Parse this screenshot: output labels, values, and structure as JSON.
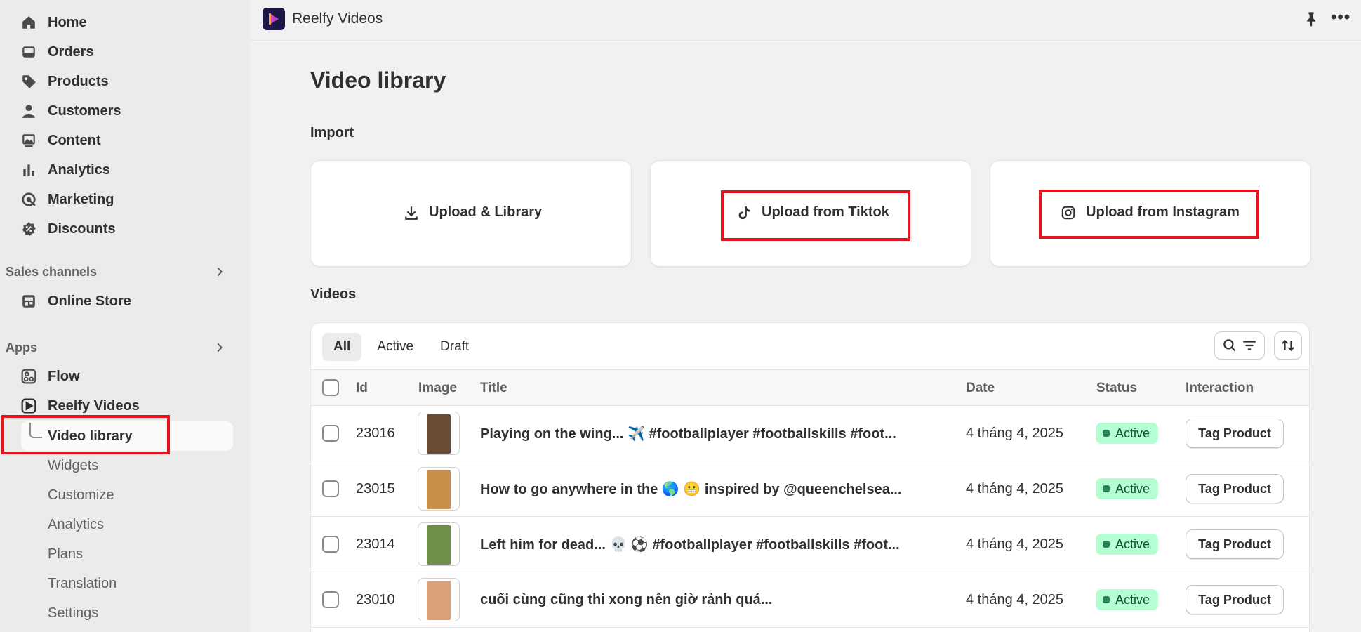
{
  "sidebar": {
    "main_items": [
      {
        "label": "Home",
        "icon": "home-icon"
      },
      {
        "label": "Orders",
        "icon": "inbox-icon"
      },
      {
        "label": "Products",
        "icon": "tag-icon"
      },
      {
        "label": "Customers",
        "icon": "person-icon"
      },
      {
        "label": "Content",
        "icon": "image-icon"
      },
      {
        "label": "Analytics",
        "icon": "bar-chart-icon"
      },
      {
        "label": "Marketing",
        "icon": "target-icon"
      },
      {
        "label": "Discounts",
        "icon": "discount-icon"
      }
    ],
    "sales_channels": {
      "title": "Sales channels",
      "items": [
        {
          "label": "Online Store",
          "icon": "store-icon"
        }
      ]
    },
    "apps": {
      "title": "Apps",
      "items": [
        {
          "label": "Flow",
          "icon": "flow-icon"
        },
        {
          "label": "Reelfy Videos",
          "icon": "play-icon"
        }
      ],
      "sub_items": [
        "Video library",
        "Widgets",
        "Customize",
        "Analytics",
        "Plans",
        "Translation",
        "Settings"
      ]
    }
  },
  "topbar": {
    "app_title": "Reelfy Videos"
  },
  "page": {
    "title": "Video library",
    "import_label": "Import",
    "import_buttons": [
      "Upload & Library",
      "Upload from Tiktok",
      "Upload from Instagram"
    ],
    "videos_label": "Videos"
  },
  "videos": {
    "tabs": [
      "All",
      "Active",
      "Draft"
    ],
    "selected_tab": "All",
    "columns": [
      "Id",
      "Image",
      "Title",
      "Date",
      "Status",
      "Interaction"
    ],
    "rows": [
      {
        "id": "23016",
        "title": "Playing on the wing... ✈️ #footballplayer #footballskills #foot...",
        "date": "4 tháng 4, 2025",
        "status": "Active",
        "action": "Tag Product",
        "thumb_color": "#6b4a36"
      },
      {
        "id": "23015",
        "title": "How to go anywhere in the 🌎 😬 inspired by @queenchelsea...",
        "date": "4 tháng 4, 2025",
        "status": "Active",
        "action": "Tag Product",
        "thumb_color": "#c78f4a"
      },
      {
        "id": "23014",
        "title": "Left him for dead... 💀 ⚽ #footballplayer #footballskills #foot...",
        "date": "4 tháng 4, 2025",
        "status": "Active",
        "action": "Tag Product",
        "thumb_color": "#6f8f4a"
      },
      {
        "id": "23010",
        "title": "cuối cùng cũng thi xong nên giờ rảnh quá...",
        "date": "4 tháng 4, 2025",
        "status": "Active",
        "action": "Tag Product",
        "thumb_color": "#d9a27a"
      }
    ]
  },
  "colors": {
    "highlight": "#e0161c",
    "active_badge_bg": "#b4fed2",
    "active_badge_text": "#0c5132",
    "app_logo_bg": "#1a1646"
  }
}
